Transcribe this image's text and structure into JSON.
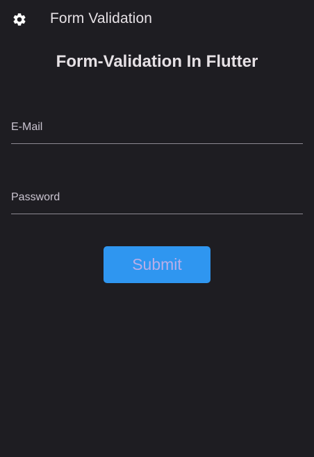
{
  "appbar": {
    "icon": "settings-gear-icon",
    "title": "Form Validation"
  },
  "form": {
    "heading": "Form-Validation In Flutter",
    "email": {
      "label": "E-Mail",
      "value": ""
    },
    "password": {
      "label": "Password",
      "value": ""
    },
    "submit_label": "Submit"
  },
  "colors": {
    "background": "#1e1d22",
    "button": "#2f96f0",
    "button_text": "#b9aee8",
    "text": "#e6e1e5",
    "underline": "#8e8a93"
  }
}
